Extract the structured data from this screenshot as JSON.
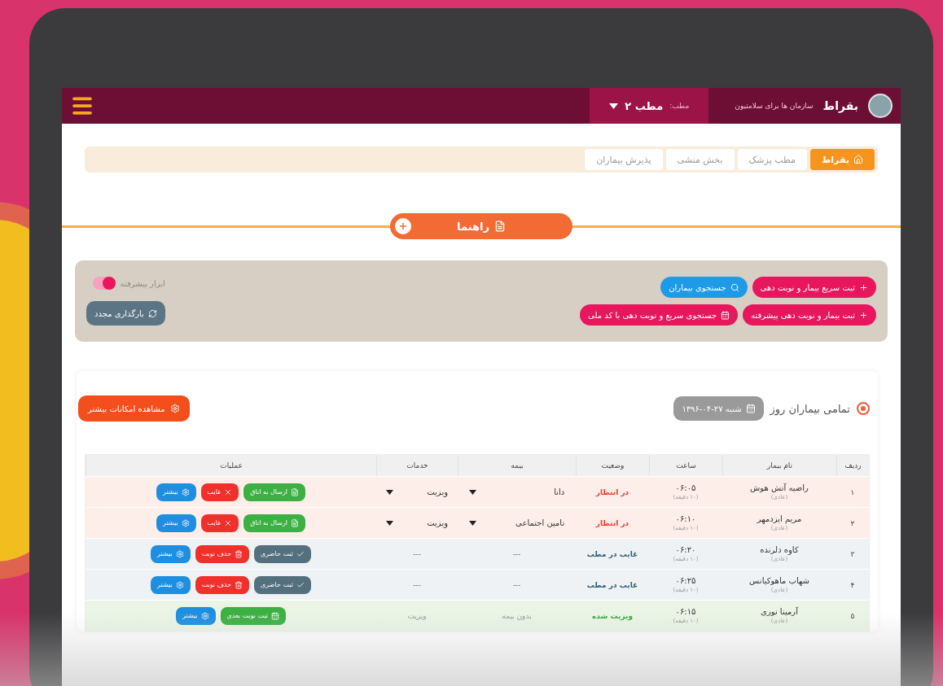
{
  "header": {
    "brand": "بقراط",
    "tagline": "سازمان ها برای سلامتیون",
    "clinic_label": "مطب:",
    "clinic": "مطب ۲"
  },
  "breadcrumb": [
    {
      "label": "بقراط",
      "selected": true
    },
    {
      "label": "مطب پزشک",
      "selected": false
    },
    {
      "label": "بخش منشی",
      "selected": false
    },
    {
      "label": "پذیرش بیماران",
      "selected": false
    }
  ],
  "guide": {
    "label": "راهنما"
  },
  "actions": [
    [
      {
        "label": "ثبت سریع بیمار و نوبت دهی",
        "kind": "add",
        "color": "#e8175d"
      },
      {
        "label": "جستجوی بیماران",
        "kind": "search",
        "color": "#1e9be8"
      }
    ],
    [
      {
        "label": "ثبت بیمار و نوبت دهی پیشرفته",
        "kind": "add",
        "color": "#e8175d"
      },
      {
        "label": "جستجوی سریع و نوبت دهی با کد ملی",
        "kind": "calendar",
        "color": "#e8175d"
      }
    ]
  ],
  "advanced": {
    "label": "ابزار پیشرفته",
    "on": true
  },
  "reload": {
    "label": "بارگذاری مجدد"
  },
  "filter": {
    "label": "تمامی بیماران روز",
    "selected": true,
    "date": "شنبه ۲۷-۰۴-۱۳۹۶"
  },
  "more_features": {
    "label": "مشاهده امکانات بیشتر"
  },
  "table": {
    "columns": [
      "ردیف",
      "نام بیمار",
      "ساعت",
      "وضعیت",
      "بیمه",
      "خدمات",
      "عملیات"
    ],
    "rows": [
      {
        "kind": "waiting",
        "index": "۱",
        "name": "راضیه آتش هوش",
        "type": "(عادی)",
        "time": "۰۶:۰۵",
        "duration": "(۱۰ دقیقه)",
        "status": "در انتظار",
        "color": "#f03a2a",
        "insurance": {
          "text": "دانا",
          "dropdown": true
        },
        "service": {
          "text": "ویزیت",
          "dropdown": true
        },
        "ops": [
          {
            "label": "ارسال به اتاق",
            "kind": "send",
            "color": "#3cb043"
          },
          {
            "label": "غایب",
            "kind": "absent",
            "color": "#f0302a"
          },
          {
            "label": "بیشتر",
            "kind": "more",
            "color": "#1e8fe0"
          }
        ]
      },
      {
        "kind": "waiting",
        "index": "۲",
        "name": "مریم ایزدمهر",
        "type": "(عادی)",
        "time": "۰۶:۱۰",
        "duration": "(۱۰ دقیقه)",
        "status": "در انتظار",
        "color": "#f03a2a",
        "insurance": {
          "text": "تامین اجتماعی",
          "dropdown": true
        },
        "service": {
          "text": "ویزیت",
          "dropdown": true
        },
        "ops": [
          {
            "label": "ارسال به اتاق",
            "kind": "send",
            "color": "#3cb043"
          },
          {
            "label": "غایب",
            "kind": "absent",
            "color": "#f0302a"
          },
          {
            "label": "بیشتر",
            "kind": "more",
            "color": "#1e8fe0"
          }
        ]
      },
      {
        "kind": "absent",
        "index": "۳",
        "name": "کاوه دلرنده",
        "type": "(عادی)",
        "time": "۰۶:۲۰",
        "duration": "(۱۰ دقیقه)",
        "status": "غایب در مطب",
        "color": "#2f5d7a",
        "insurance": {
          "text": "---",
          "dropdown": false
        },
        "service": {
          "text": "---",
          "dropdown": false
        },
        "ops": [
          {
            "label": "ثبت حاضری",
            "kind": "present",
            "color": "#54707f"
          },
          {
            "label": "حذف نوبت",
            "kind": "delete",
            "color": "#f0302a"
          },
          {
            "label": "بیشتر",
            "kind": "more",
            "color": "#1e8fe0"
          }
        ]
      },
      {
        "kind": "absent",
        "index": "۴",
        "name": "شهاب ماهوکیانس",
        "type": "(عادی)",
        "time": "۰۶:۲۵",
        "duration": "(۱۰ دقیقه)",
        "status": "غایب در مطب",
        "color": "#2f5d7a",
        "insurance": {
          "text": "---",
          "dropdown": false
        },
        "service": {
          "text": "---",
          "dropdown": false
        },
        "ops": [
          {
            "label": "ثبت حاضری",
            "kind": "present",
            "color": "#54707f"
          },
          {
            "label": "حذف نوبت",
            "kind": "delete",
            "color": "#f0302a"
          },
          {
            "label": "بیشتر",
            "kind": "more",
            "color": "#1e8fe0"
          }
        ]
      },
      {
        "kind": "visited",
        "index": "۵",
        "name": "آرمینا نوری",
        "type": "(عادی)",
        "time": "۰۶:۱۵",
        "duration": "(۱۰ دقیقه)",
        "status": "ویزیت شده",
        "color": "#2ea836",
        "insurance": {
          "text": "بدون بیمه",
          "dropdown": false
        },
        "service": {
          "text": "ویزیت",
          "dropdown": false
        },
        "ops": [
          {
            "label": "ثبت نوبت بعدی",
            "kind": "next",
            "color": "#3cb043"
          },
          {
            "label": "بیشتر",
            "kind": "more",
            "color": "#1e8fe0"
          }
        ]
      }
    ]
  }
}
